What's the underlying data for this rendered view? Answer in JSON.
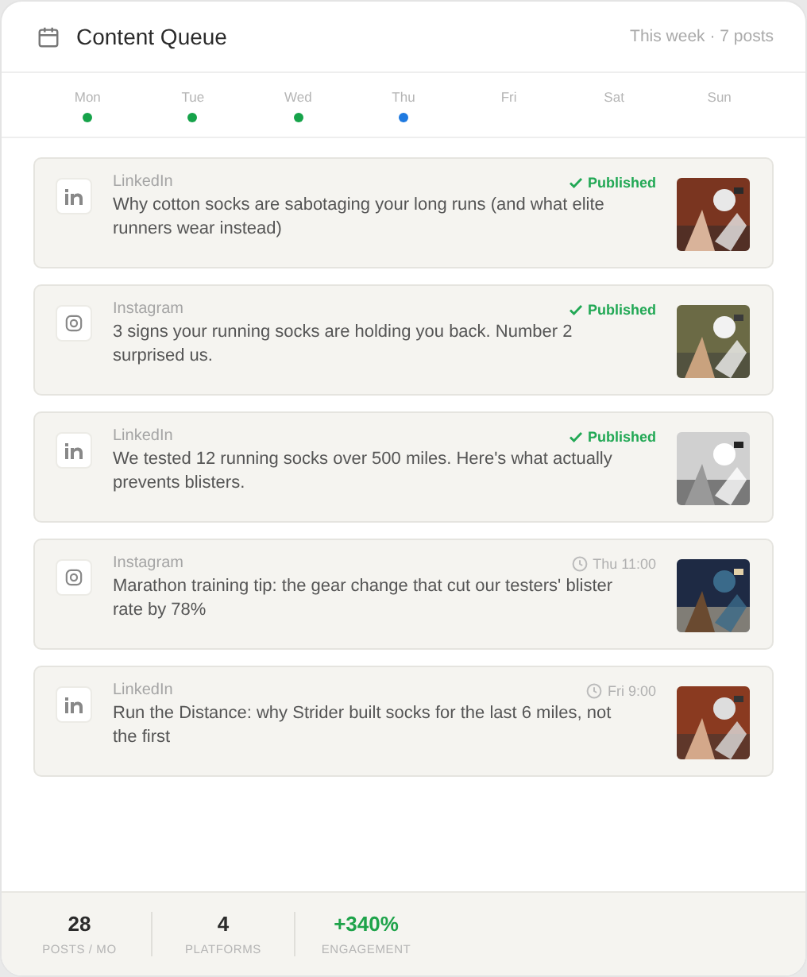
{
  "header": {
    "title": "Content Queue",
    "summary": "This week · 7 posts"
  },
  "days": [
    {
      "label": "Mon",
      "color": "#16a34a"
    },
    {
      "label": "Tue",
      "color": "#16a34a"
    },
    {
      "label": "Wed",
      "color": "#16a34a"
    },
    {
      "label": "Thu",
      "color": "#1f7ae0"
    },
    {
      "label": "Fri"
    },
    {
      "label": "Sat"
    },
    {
      "label": "Sun"
    }
  ],
  "posts": [
    {
      "platform": {
        "kind": "linkedin",
        "name": "LinkedIn"
      },
      "status": {
        "kind": "published",
        "label": "Published"
      },
      "text": "Why cotton socks are sabotaging your long runs (and what elite runners wear instead)"
    },
    {
      "platform": {
        "kind": "instagram",
        "name": "Instagram"
      },
      "status": {
        "kind": "published",
        "label": "Published"
      },
      "text": "3 signs your running socks are holding you back. Number 2 surprised us."
    },
    {
      "platform": {
        "kind": "linkedin",
        "name": "LinkedIn"
      },
      "status": {
        "kind": "published",
        "label": "Published"
      },
      "text": "We tested 12 running socks over 500 miles. Here's what actually prevents blisters."
    },
    {
      "platform": {
        "kind": "instagram",
        "name": "Instagram"
      },
      "status": {
        "kind": "scheduled",
        "label": "Thu 11:00"
      },
      "text": "Marathon training tip: the gear change that cut our testers' blister rate by 78%"
    },
    {
      "platform": {
        "kind": "linkedin",
        "name": "LinkedIn"
      },
      "status": {
        "kind": "scheduled",
        "label": "Fri 9:00"
      },
      "text": "Run the Distance: why Strider built socks for the last 6 miles, not the first"
    }
  ],
  "stats": [
    {
      "value": "28",
      "label": "POSTS / MO",
      "positive": false
    },
    {
      "value": "4",
      "label": "PLATFORMS",
      "positive": false
    },
    {
      "value": "+340%",
      "label": "ENGAGEMENT",
      "positive": true
    }
  ]
}
